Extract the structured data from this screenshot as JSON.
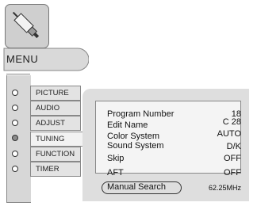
{
  "menu": {
    "title": "MENU"
  },
  "tabs": [
    {
      "label": "PICTURE",
      "selected": false
    },
    {
      "label": "AUDIO",
      "selected": false
    },
    {
      "label": "ADJUST",
      "selected": false
    },
    {
      "label": "TUNING",
      "selected": true
    },
    {
      "label": "FUNCTION",
      "selected": false
    },
    {
      "label": "TIMER",
      "selected": false
    }
  ],
  "tuning": {
    "rows": [
      {
        "label": "Program Number",
        "value": "18"
      },
      {
        "label": "Edit Name",
        "value": "C 28"
      },
      {
        "label": "Color System",
        "value": "AUTO"
      },
      {
        "label": "Sound System",
        "value": "D/K"
      },
      {
        "label": "Skip",
        "value": "OFF"
      },
      {
        "label": "AFT",
        "value": "OFF"
      },
      {
        "label": "Manual Search",
        "value": "62.25MHz"
      }
    ]
  },
  "icons": {
    "logo": "connector-plug-icon"
  },
  "colors": {
    "panel": "#dedede",
    "tab": "#e3e3e3",
    "selected_radio": "#8a8a8a"
  }
}
